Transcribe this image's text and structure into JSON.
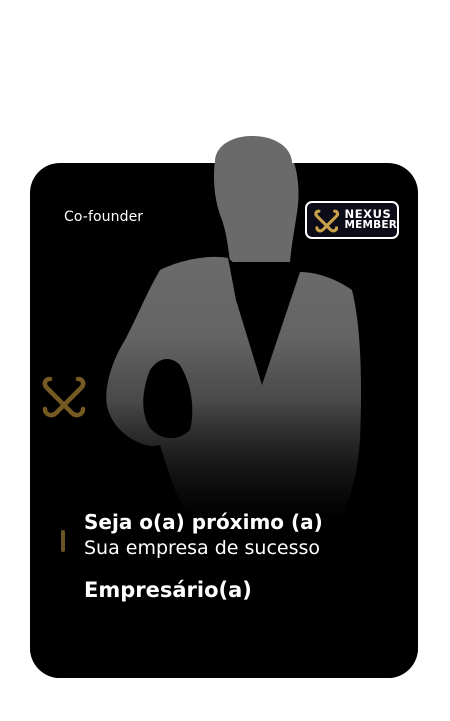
{
  "card": {
    "role": "Co-founder",
    "badge": {
      "line1": "NEXUS",
      "line2": "MEMBER",
      "icon": "nexus-x-logo-icon"
    },
    "watermark_icon": "nexus-x-watermark-icon",
    "headline": "Seja o(a) próximo (a)",
    "subline": "Sua empresa de sucesso",
    "title": "Empresário(a)"
  },
  "colors": {
    "card_background": "#000000",
    "silhouette": "#6a6a6a",
    "accent_gold": "#c9a14a",
    "text": "#ffffff"
  }
}
